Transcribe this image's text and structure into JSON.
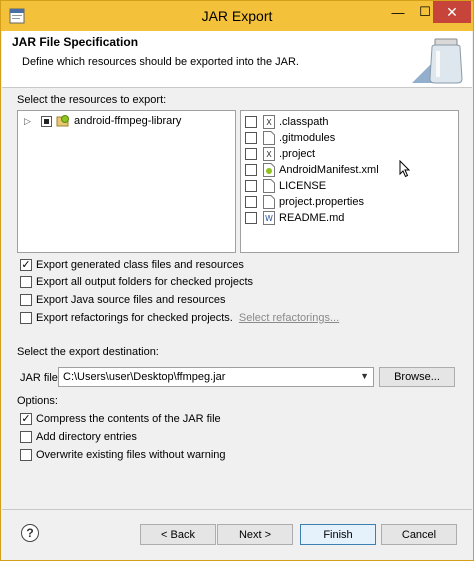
{
  "window": {
    "title": "JAR Export",
    "close_glyph": "✕",
    "min_glyph": "—",
    "max_glyph": "☐"
  },
  "header": {
    "title": "JAR File Specification",
    "description": "Define which resources should be exported into the JAR."
  },
  "resources": {
    "label": "Select the resources to export:",
    "project": {
      "name": "android-ffmpeg-library",
      "expander": "▷",
      "icon": "android-project-icon"
    },
    "files": [
      {
        "name": ".classpath",
        "icon": "xml-file-icon",
        "checked": false
      },
      {
        "name": ".gitmodules",
        "icon": "text-file-icon",
        "checked": false
      },
      {
        "name": ".project",
        "icon": "xml-file-icon",
        "checked": false
      },
      {
        "name": "AndroidManifest.xml",
        "icon": "manifest-file-icon",
        "checked": false
      },
      {
        "name": "LICENSE",
        "icon": "text-file-icon",
        "checked": false
      },
      {
        "name": "project.properties",
        "icon": "text-file-icon",
        "checked": false
      },
      {
        "name": "README.md",
        "icon": "word-file-icon",
        "checked": false
      }
    ]
  },
  "export_options": {
    "generated_class_files": {
      "label": "Export generated class files and resources",
      "checked": true
    },
    "output_folders": {
      "label": "Export all output folders for checked projects",
      "checked": false
    },
    "java_source": {
      "label": "Export Java source files and resources",
      "checked": false
    },
    "refactorings": {
      "label": "Export refactorings for checked projects.",
      "checked": false,
      "link": "Select refactorings..."
    }
  },
  "destination": {
    "label": "Select the export destination:",
    "jar_file_label": "JAR file:",
    "jar_file_value": "C:\\Users\\user\\Desktop\\ffmpeg.jar",
    "browse_label": "Browse..."
  },
  "options": {
    "label": "Options:",
    "compress": {
      "label": "Compress the contents of the JAR file",
      "checked": true
    },
    "directory_entries": {
      "label": "Add directory entries",
      "checked": false
    },
    "overwrite": {
      "label": "Overwrite existing files without warning",
      "checked": false
    }
  },
  "buttons": {
    "help": "?",
    "back": "< Back",
    "next": "Next >",
    "finish": "Finish",
    "cancel": "Cancel"
  },
  "colors": {
    "titlebar": "#f3c23a",
    "close": "#c7443a"
  }
}
